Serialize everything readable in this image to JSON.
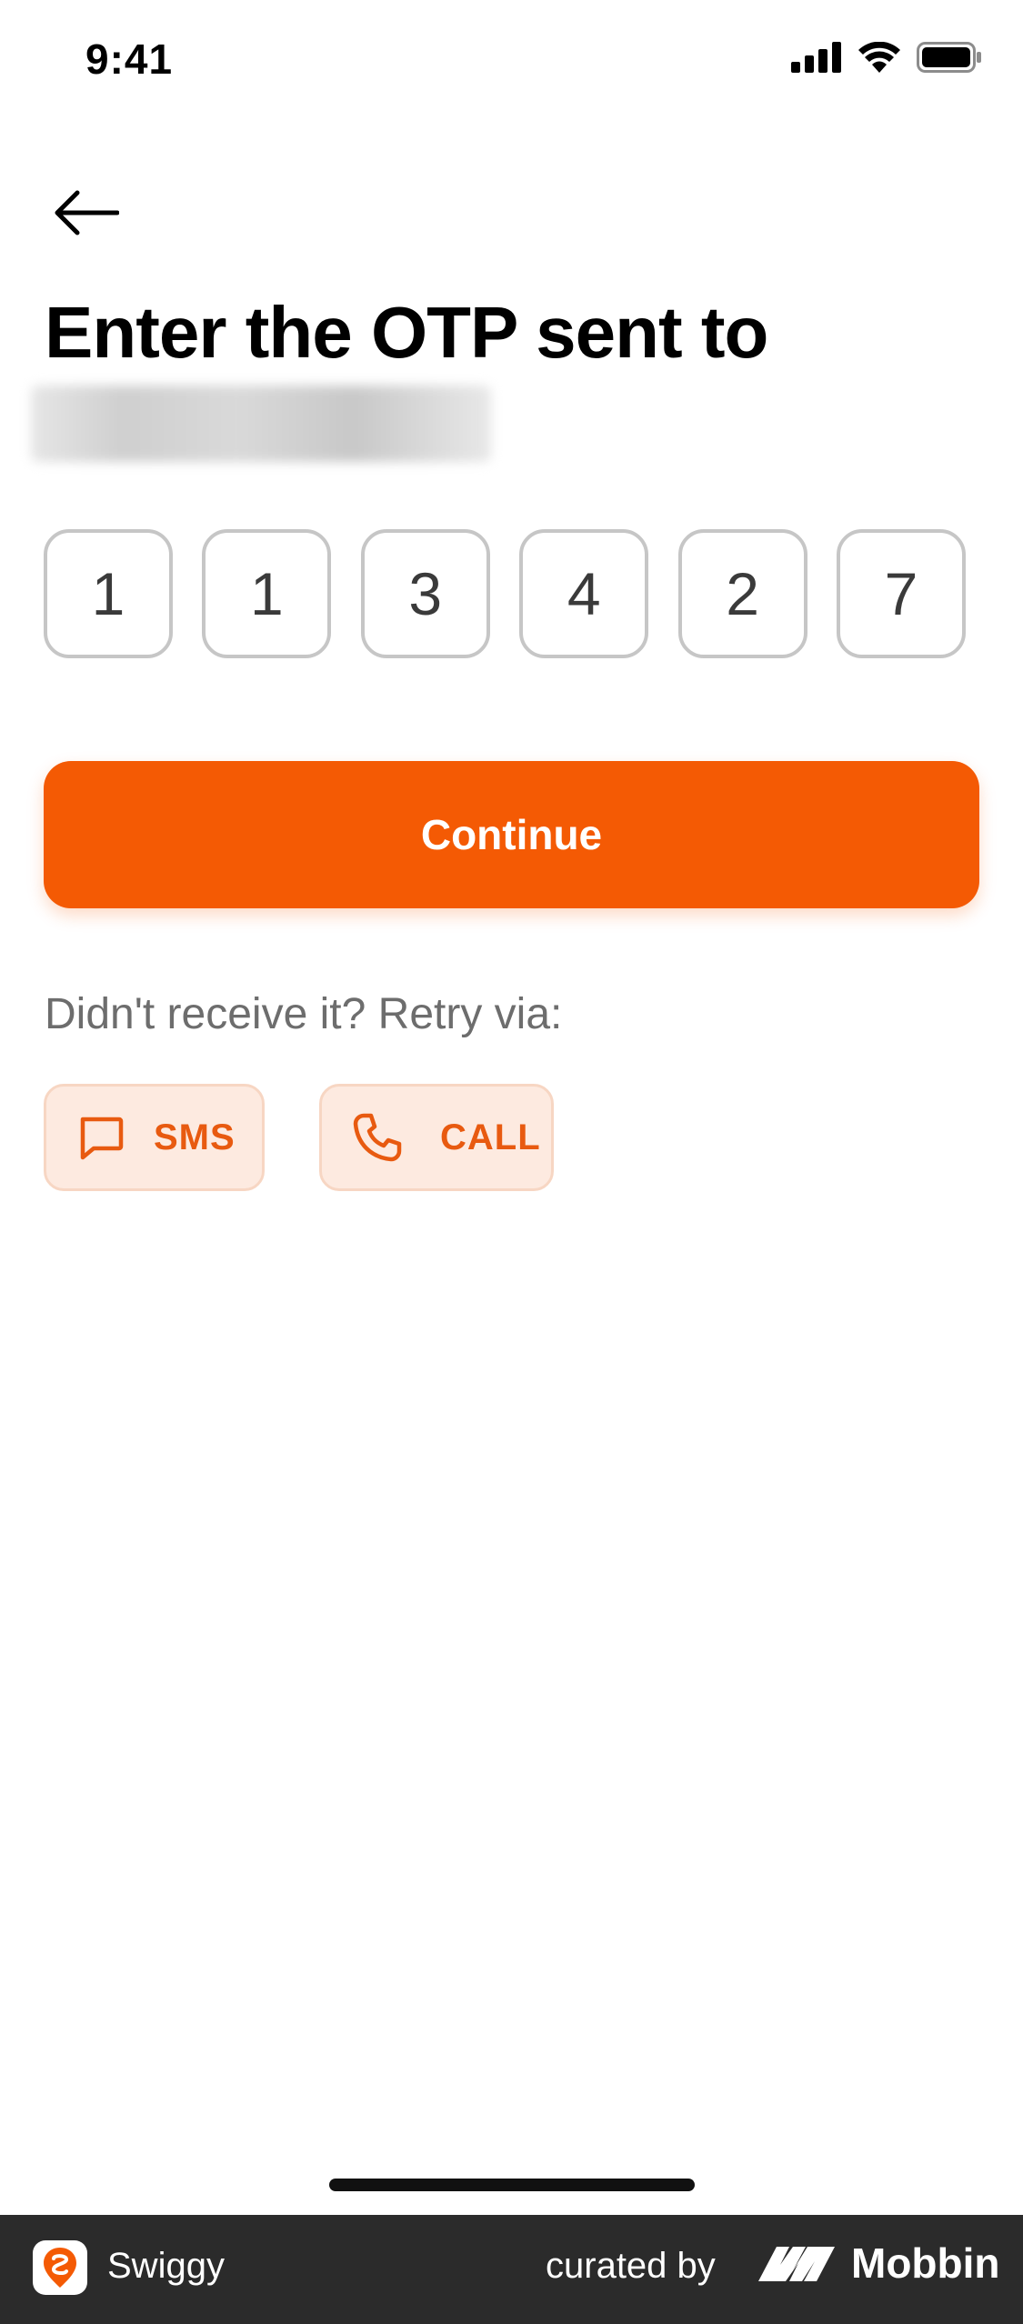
{
  "status_bar": {
    "time": "9:41",
    "icons": [
      "cellular-signal-icon",
      "wifi-icon",
      "battery-icon"
    ]
  },
  "header": {
    "back_icon": "arrow-left-icon",
    "title": "Enter the OTP sent to"
  },
  "otp": {
    "digits": [
      "1",
      "1",
      "3",
      "4",
      "2",
      "7"
    ]
  },
  "actions": {
    "continue_label": "Continue"
  },
  "retry": {
    "prompt": "Didn't receive it? Retry via:",
    "sms_label": "SMS",
    "call_label": "CALL"
  },
  "footer": {
    "app_name": "Swiggy",
    "curated_by": "curated by",
    "brand": "Mobbin"
  },
  "colors": {
    "accent": "#f45a04",
    "retry_bg": "#fdeae0",
    "retry_text": "#e85a10",
    "otp_border": "#c6c6c6",
    "footer_bg": "#2b2b2b"
  }
}
